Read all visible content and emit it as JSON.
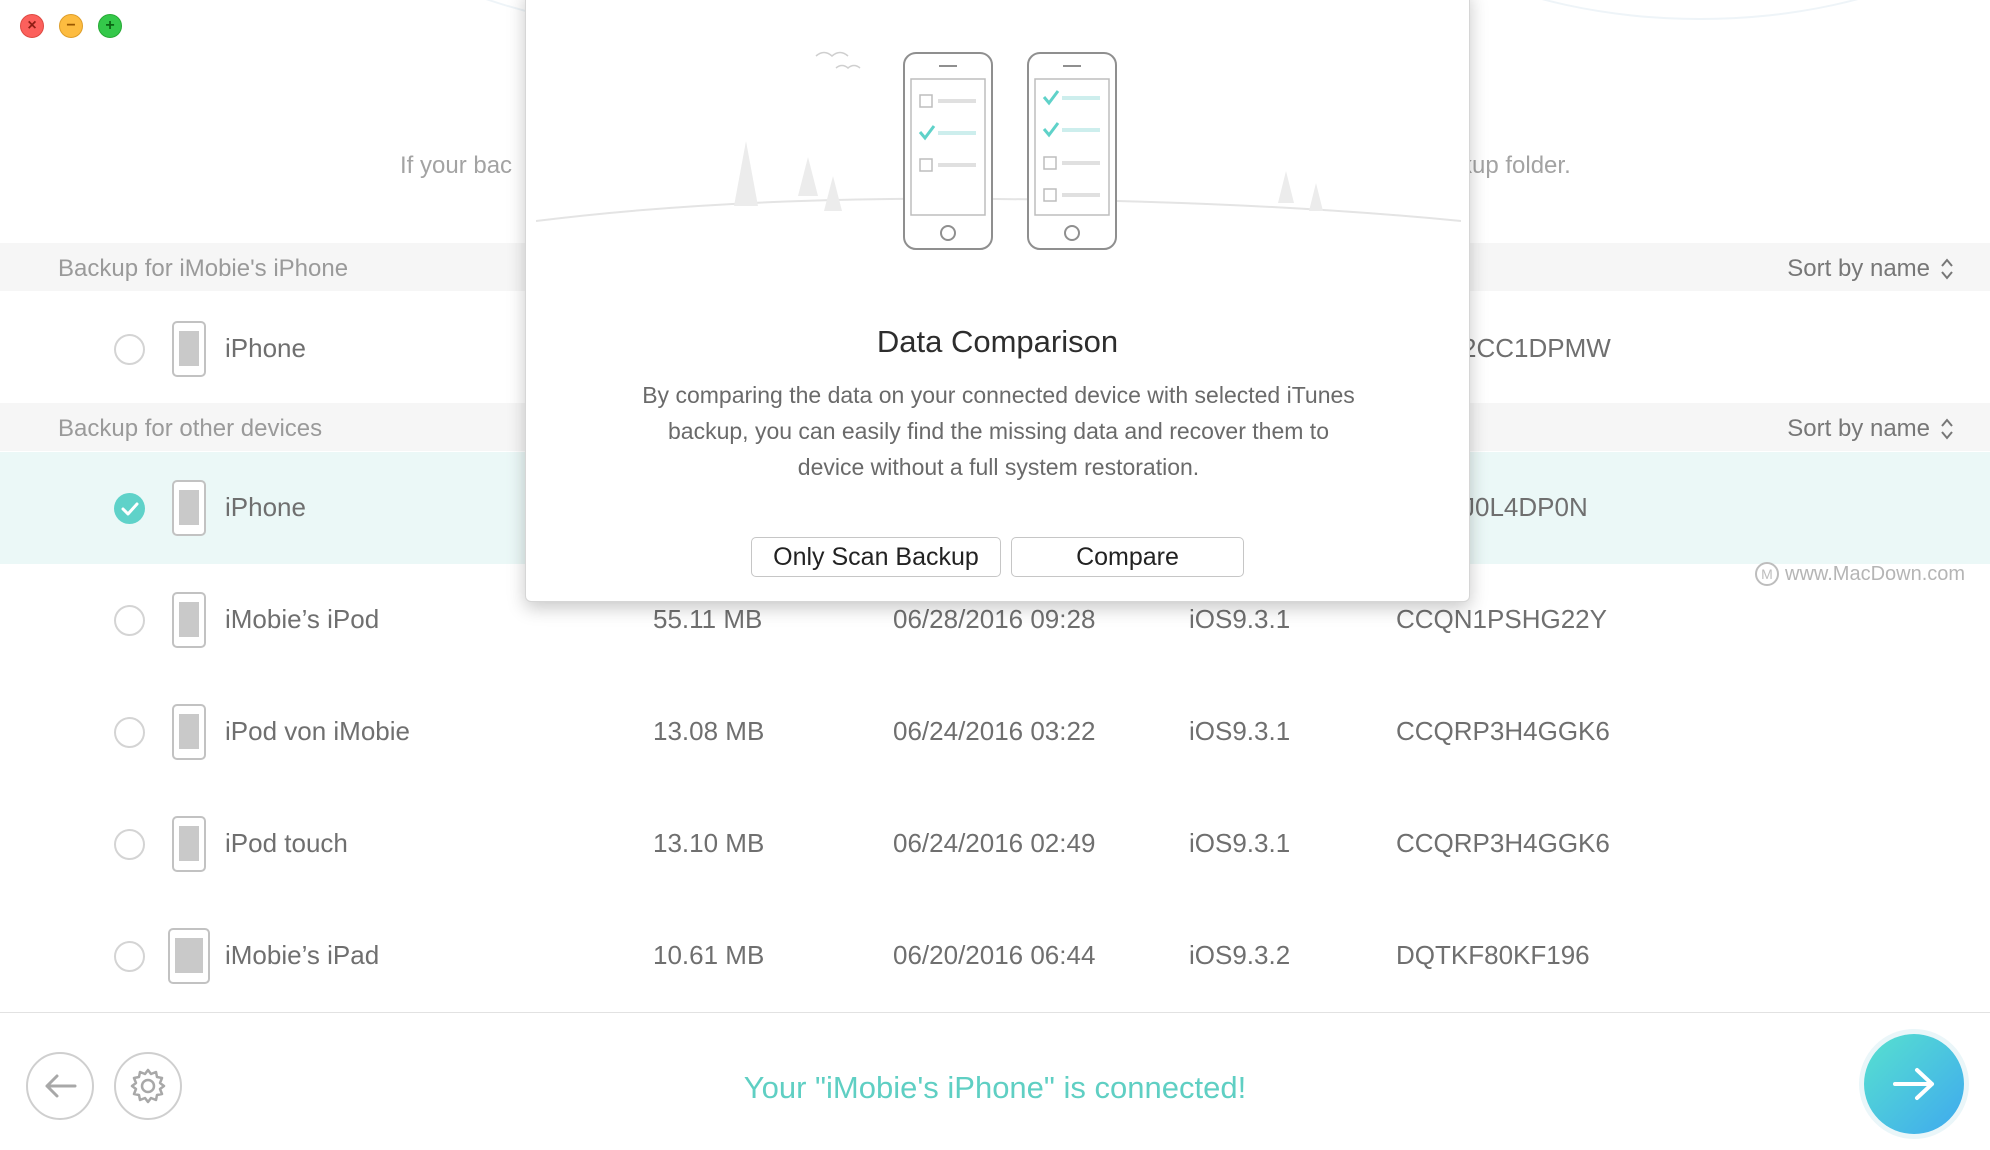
{
  "window": {
    "controls": {
      "close_icon": "×",
      "minimize_icon": "−",
      "maximize_icon": "+"
    }
  },
  "header": {
    "hint_left": "If your bac",
    "hint_right": "kup folder."
  },
  "sections": {
    "own": {
      "title": "Backup for iMobie's iPhone",
      "sort_label": "Sort by name"
    },
    "other": {
      "title": "Backup for other devices",
      "sort_label": "Sort by name"
    }
  },
  "rows": [
    {
      "name": "iPhone",
      "serial_partial": "2CC1DPMW",
      "checked": false
    },
    {
      "name": "iPhone",
      "serial_partial": "J0L4DP0N",
      "checked": true
    },
    {
      "name": "iMobie’s iPod",
      "size": "55.11 MB",
      "date": "06/28/2016 09:28",
      "ios": "iOS9.3.1",
      "serial": "CCQN1PSHG22Y",
      "checked": false
    },
    {
      "name": "iPod von iMobie",
      "size": "13.08 MB",
      "date": "06/24/2016 03:22",
      "ios": "iOS9.3.1",
      "serial": "CCQRP3H4GGK6",
      "checked": false
    },
    {
      "name": "iPod touch",
      "size": "13.10 MB",
      "date": "06/24/2016 02:49",
      "ios": "iOS9.3.1",
      "serial": "CCQRP3H4GGK6",
      "checked": false
    },
    {
      "name": "iMobie’s iPad",
      "size": "10.61 MB",
      "date": "06/20/2016 06:44",
      "ios": "iOS9.3.2",
      "serial": "DQTKF80KF196",
      "checked": false
    }
  ],
  "modal": {
    "title": "Data Comparison",
    "description": "By comparing the data on your connected device with selected iTunes backup, you can easily find the missing data and recover them to device without a full system restoration.",
    "scan_button": "Only Scan Backup",
    "compare_button": "Compare"
  },
  "watermark": {
    "text": "www.MacDown.com",
    "icon": "M"
  },
  "footer": {
    "status": "Your \"iMobie's iPhone\" is connected!",
    "accent_color": "#5fcfc3",
    "icons": {
      "back": "arrow-left-icon",
      "settings": "gear-icon",
      "next": "arrow-right-icon"
    }
  }
}
